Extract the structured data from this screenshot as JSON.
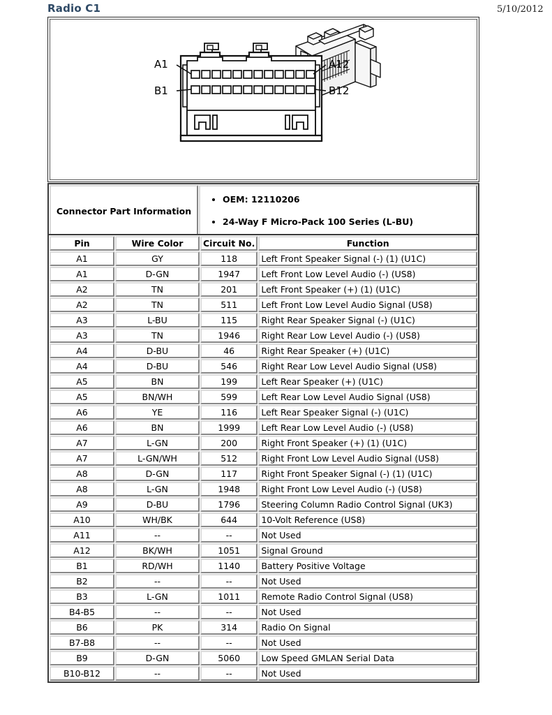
{
  "header": {
    "title": "Radio C1",
    "date": "5/10/2012"
  },
  "diagram": {
    "front_view_labels": {
      "top_left": "A1",
      "top_right": "A12",
      "bottom_left": "B1",
      "bottom_right": "B12"
    },
    "pin_rows": 2,
    "pins_per_row": 12
  },
  "part_info": {
    "label": "Connector Part Information",
    "bullets": [
      "OEM: 12110206",
      "24-Way F Micro-Pack 100 Series (L-BU)"
    ]
  },
  "pinout": {
    "columns": [
      "Pin",
      "Wire Color",
      "Circuit No.",
      "Function"
    ],
    "rows": [
      [
        "A1",
        "GY",
        "118",
        "Left Front Speaker Signal (-) (1) (U1C)"
      ],
      [
        "A1",
        "D-GN",
        "1947",
        "Left Front Low Level Audio (-) (US8)"
      ],
      [
        "A2",
        "TN",
        "201",
        "Left Front Speaker (+) (1) (U1C)"
      ],
      [
        "A2",
        "TN",
        "511",
        "Left Front Low Level Audio Signal (US8)"
      ],
      [
        "A3",
        "L-BU",
        "115",
        "Right Rear Speaker Signal (-) (U1C)"
      ],
      [
        "A3",
        "TN",
        "1946",
        "Right Rear Low Level Audio (-) (US8)"
      ],
      [
        "A4",
        "D-BU",
        "46",
        "Right Rear Speaker (+) (U1C)"
      ],
      [
        "A4",
        "D-BU",
        "546",
        "Right Rear Low Level Audio Signal (US8)"
      ],
      [
        "A5",
        "BN",
        "199",
        "Left Rear Speaker (+) (U1C)"
      ],
      [
        "A5",
        "BN/WH",
        "599",
        "Left Rear Low Level Audio Signal (US8)"
      ],
      [
        "A6",
        "YE",
        "116",
        "Left Rear Speaker Signal (-) (U1C)"
      ],
      [
        "A6",
        "BN",
        "1999",
        "Left Rear Low Level Audio (-) (US8)"
      ],
      [
        "A7",
        "L-GN",
        "200",
        "Right Front Speaker (+) (1) (U1C)"
      ],
      [
        "A7",
        "L-GN/WH",
        "512",
        "Right Front Low Level Audio Signal (US8)"
      ],
      [
        "A8",
        "D-GN",
        "117",
        "Right Front Speaker Signal (-) (1) (U1C)"
      ],
      [
        "A8",
        "L-GN",
        "1948",
        "Right Front Low Level Audio (-) (US8)"
      ],
      [
        "A9",
        "D-BU",
        "1796",
        "Steering Column Radio Control Signal (UK3)"
      ],
      [
        "A10",
        "WH/BK",
        "644",
        "10-Volt Reference (US8)"
      ],
      [
        "A11",
        "--",
        "--",
        "Not Used"
      ],
      [
        "A12",
        "BK/WH",
        "1051",
        "Signal Ground"
      ],
      [
        "B1",
        "RD/WH",
        "1140",
        "Battery Positive Voltage"
      ],
      [
        "B2",
        "--",
        "--",
        "Not Used"
      ],
      [
        "B3",
        "L-GN",
        "1011",
        "Remote Radio Control Signal (US8)"
      ],
      [
        "B4-B5",
        "--",
        "--",
        "Not Used"
      ],
      [
        "B6",
        "PK",
        "314",
        "Radio On Signal"
      ],
      [
        "B7-B8",
        "--",
        "--",
        "Not Used"
      ],
      [
        "B9",
        "D-GN",
        "5060",
        "Low Speed GMLAN Serial Data"
      ],
      [
        "B10-B12",
        "--",
        "--",
        "Not Used"
      ]
    ]
  }
}
